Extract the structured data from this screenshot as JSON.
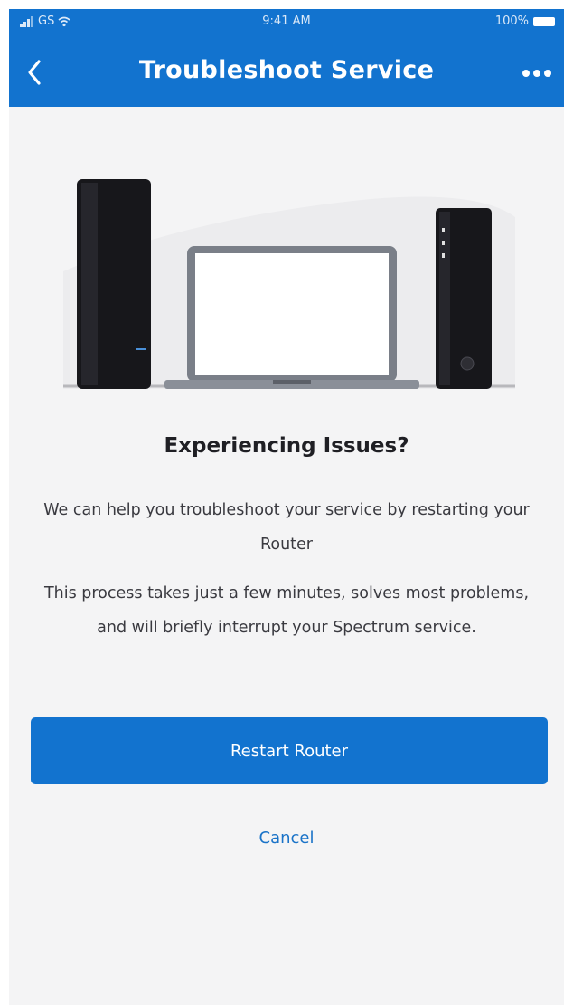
{
  "status_bar": {
    "carrier": "GS",
    "time": "9:41 AM",
    "battery": "100%"
  },
  "header": {
    "title": "Troubleshoot Service",
    "back_icon": "chevron-left-icon",
    "more_icon": "more-horizontal-icon"
  },
  "illustration": {
    "icons": [
      "router-icon",
      "laptop-icon",
      "modem-icon"
    ]
  },
  "content": {
    "heading": "Experiencing Issues?",
    "paragraph_1": "We can help you troubleshoot your service by restarting your Router",
    "paragraph_2": "This process takes just a few minutes, solves most problems, and will briefly interrupt your Spectrum service."
  },
  "actions": {
    "primary_label": "Restart Router",
    "cancel_label": "Cancel"
  },
  "colors": {
    "brand": "#1273cf",
    "background": "#f4f4f5",
    "link": "#1a73c8"
  }
}
